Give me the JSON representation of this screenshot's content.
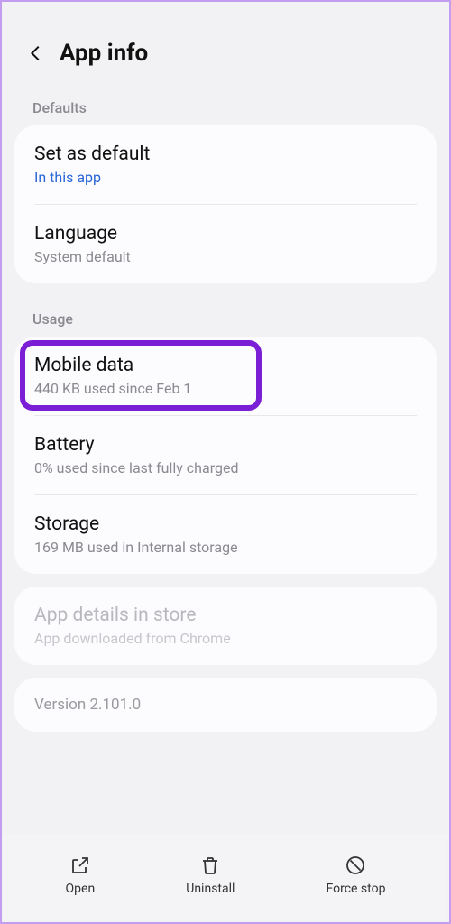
{
  "header": {
    "title": "App info"
  },
  "sections": {
    "defaults": {
      "label": "Defaults",
      "set_as_default": {
        "title": "Set as default",
        "sub": "In this app"
      },
      "language": {
        "title": "Language",
        "sub": "System default"
      }
    },
    "usage": {
      "label": "Usage",
      "mobile_data": {
        "title": "Mobile data",
        "sub": "440 KB used since Feb 1"
      },
      "battery": {
        "title": "Battery",
        "sub": "0% used since last fully charged"
      },
      "storage": {
        "title": "Storage",
        "sub": "169 MB used in Internal storage"
      }
    },
    "store": {
      "title": "App details in store",
      "sub": "App downloaded from Chrome"
    },
    "version": {
      "title": "Version 2.101.0"
    }
  },
  "actions": {
    "open": {
      "label": "Open"
    },
    "uninstall": {
      "label": "Uninstall"
    },
    "force_stop": {
      "label": "Force stop"
    }
  }
}
